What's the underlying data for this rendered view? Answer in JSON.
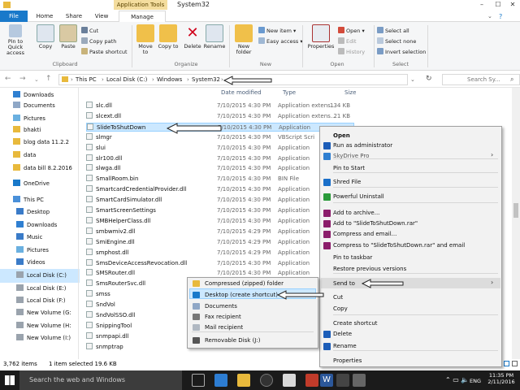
{
  "window": {
    "title": "System32",
    "context_tab_group": "Application Tools"
  },
  "tabs": [
    "File",
    "Home",
    "Share",
    "View",
    "Manage"
  ],
  "ribbon": {
    "clipboard": {
      "label": "Clipboard",
      "pin": "Pin to Quick access",
      "copy": "Copy",
      "paste": "Paste",
      "cut": "Cut",
      "copy_path": "Copy path",
      "paste_shortcut": "Paste shortcut"
    },
    "organize": {
      "label": "Organize",
      "move_to": "Move to",
      "copy_to": "Copy to",
      "delete": "Delete",
      "rename": "Rename"
    },
    "new": {
      "label": "New",
      "new_folder": "New folder",
      "new_item": "New item",
      "easy_access": "Easy access"
    },
    "open": {
      "label": "Open",
      "properties": "Properties",
      "open": "Open",
      "edit": "Edit",
      "history": "History"
    },
    "select": {
      "label": "Select",
      "select_all": "Select all",
      "select_none": "Select none",
      "invert": "Invert selection"
    }
  },
  "address": {
    "crumbs": [
      "This PC",
      "Local Disk (C:)",
      "Windows",
      "System32"
    ],
    "search_placeholder": "Search Sy..."
  },
  "navpane": [
    {
      "label": "Downloads",
      "icon": "downloads-icon"
    },
    {
      "label": "Documents",
      "icon": "documents-icon"
    },
    {
      "label": "Pictures",
      "icon": "pictures-icon"
    },
    {
      "label": "bhakti",
      "icon": "folder-icon"
    },
    {
      "label": "blog data 11.2.2",
      "icon": "folder-icon"
    },
    {
      "label": "data",
      "icon": "folder-icon"
    },
    {
      "label": "data bill 8.2.2016",
      "icon": "folder-icon"
    },
    {
      "label": "OneDrive",
      "icon": "onedrive-icon"
    },
    {
      "label": "This PC",
      "icon": "computer-icon"
    },
    {
      "label": "Desktop",
      "icon": "desktop-icon"
    },
    {
      "label": "Downloads",
      "icon": "downloads-icon"
    },
    {
      "label": "Music",
      "icon": "music-icon"
    },
    {
      "label": "Pictures",
      "icon": "pictures-icon"
    },
    {
      "label": "Videos",
      "icon": "videos-icon"
    },
    {
      "label": "Local Disk (C:)",
      "icon": "drive-icon"
    },
    {
      "label": "Local Disk (E:)",
      "icon": "drive-icon"
    },
    {
      "label": "Local Disk (F:)",
      "icon": "drive-icon"
    },
    {
      "label": "New Volume (G:",
      "icon": "drive-icon"
    },
    {
      "label": "New Volume (H:",
      "icon": "drive-icon"
    },
    {
      "label": "New Volume (I:)",
      "icon": "drive-icon"
    }
  ],
  "columns": {
    "date": "Date modified",
    "type": "Type",
    "size": "Size"
  },
  "files": [
    {
      "name": "slc.dll",
      "date": "7/10/2015 4:30 PM",
      "type": "Application extens...",
      "size": "134 KB"
    },
    {
      "name": "slcext.dll",
      "date": "7/10/2015 4:30 PM",
      "type": "Application extens...",
      "size": "21 KB"
    },
    {
      "name": "SlideToShutDown",
      "date": "7/10/2015 4:30 PM",
      "type": "Application",
      "size": ""
    },
    {
      "name": "slmgr",
      "date": "7/10/2015 4:30 PM",
      "type": "VBScript Scri",
      "size": ""
    },
    {
      "name": "slui",
      "date": "7/10/2015 4:30 PM",
      "type": "Application",
      "size": ""
    },
    {
      "name": "slr100.dll",
      "date": "7/10/2015 4:30 PM",
      "type": "Application",
      "size": ""
    },
    {
      "name": "slwga.dll",
      "date": "7/10/2015 4:30 PM",
      "type": "Application",
      "size": ""
    },
    {
      "name": "SmallRoom.bin",
      "date": "7/10/2015 4:30 PM",
      "type": "BIN File",
      "size": ""
    },
    {
      "name": "SmartcardCredentialProvider.dll",
      "date": "7/10/2015 4:30 PM",
      "type": "Application",
      "size": ""
    },
    {
      "name": "SmartCardSimulator.dll",
      "date": "7/10/2015 4:30 PM",
      "type": "Application",
      "size": ""
    },
    {
      "name": "SmartScreenSettings",
      "date": "7/10/2015 4:30 PM",
      "type": "Application",
      "size": ""
    },
    {
      "name": "SMBHelperClass.dll",
      "date": "7/10/2015 4:30 PM",
      "type": "Application",
      "size": ""
    },
    {
      "name": "smbwmiv2.dll",
      "date": "7/10/2015 4:29 PM",
      "type": "Application",
      "size": ""
    },
    {
      "name": "SmiEngine.dll",
      "date": "7/10/2015 4:29 PM",
      "type": "Application",
      "size": ""
    },
    {
      "name": "smphost.dll",
      "date": "7/10/2015 4:29 PM",
      "type": "Application",
      "size": ""
    },
    {
      "name": "SmsDeviceAccessRevocation.dll",
      "date": "7/10/2015 4:30 PM",
      "type": "Application",
      "size": ""
    },
    {
      "name": "SMSRouter.dll",
      "date": "7/10/2015 4:30 PM",
      "type": "Application",
      "size": ""
    },
    {
      "name": "SmsRouterSvc.dll",
      "date": "7/10/2015 4:30 PM",
      "type": "Application",
      "size": ""
    },
    {
      "name": "smss",
      "date": "",
      "type": "",
      "size": ""
    },
    {
      "name": "SndVol",
      "date": "",
      "type": "",
      "size": ""
    },
    {
      "name": "SndVolSSO.dll",
      "date": "",
      "type": "",
      "size": ""
    },
    {
      "name": "SnippingTool",
      "date": "",
      "type": "",
      "size": ""
    },
    {
      "name": "snmpapi.dll",
      "date": "",
      "type": "",
      "size": ""
    },
    {
      "name": "snmptrap",
      "date": "",
      "type": "",
      "size": ""
    }
  ],
  "context_menu": [
    {
      "label": "Open",
      "icon": ""
    },
    {
      "label": "Run as administrator",
      "icon": "shield-icon"
    },
    {
      "label": "SkyDrive Pro",
      "icon": "skydrive-icon"
    },
    {
      "label": "Pin to Start",
      "icon": ""
    },
    {
      "label": "Shred File",
      "icon": "shred-icon"
    },
    {
      "label": "Powerful Uninstall",
      "icon": "uninstall-icon"
    },
    {
      "label": "Add to archive...",
      "icon": "winrar-icon"
    },
    {
      "label": "Add to \"SlideToShutDown.rar\"",
      "icon": "winrar-icon"
    },
    {
      "label": "Compress and email...",
      "icon": "winrar-icon"
    },
    {
      "label": "Compress to \"SlideToShutDown.rar\" and email",
      "icon": "winrar-icon"
    },
    {
      "label": "Pin to taskbar",
      "icon": ""
    },
    {
      "label": "Restore previous versions",
      "icon": ""
    },
    {
      "label": "Send to",
      "icon": ""
    },
    {
      "label": "Cut",
      "icon": ""
    },
    {
      "label": "Copy",
      "icon": ""
    },
    {
      "label": "Create shortcut",
      "icon": ""
    },
    {
      "label": "Delete",
      "icon": "shield-icon"
    },
    {
      "label": "Rename",
      "icon": "shield-icon"
    },
    {
      "label": "Properties",
      "icon": ""
    }
  ],
  "send_to_menu": [
    {
      "label": "Compressed (zipped) folder",
      "icon": "zip-folder-icon"
    },
    {
      "label": "Desktop (create shortcut)",
      "icon": "desktop-icon"
    },
    {
      "label": "Documents",
      "icon": "documents-icon"
    },
    {
      "label": "Fax recipient",
      "icon": "fax-icon"
    },
    {
      "label": "Mail recipient",
      "icon": "mail-icon"
    },
    {
      "label": "Removable Disk (J:)",
      "icon": "removable-disk-icon"
    }
  ],
  "status": {
    "count": "3,762 items",
    "selection": "1 item selected  19.6 KB"
  },
  "taskbar": {
    "search_text": "Search the web and Windows",
    "lang": "ENG",
    "time": "11:35 PM",
    "date": "2/11/2016"
  },
  "colors": {
    "accent": "#1979ca",
    "taskbar": "#1b1b1b",
    "selection": "#cce8ff",
    "app_tools": "#f4dd9e"
  }
}
